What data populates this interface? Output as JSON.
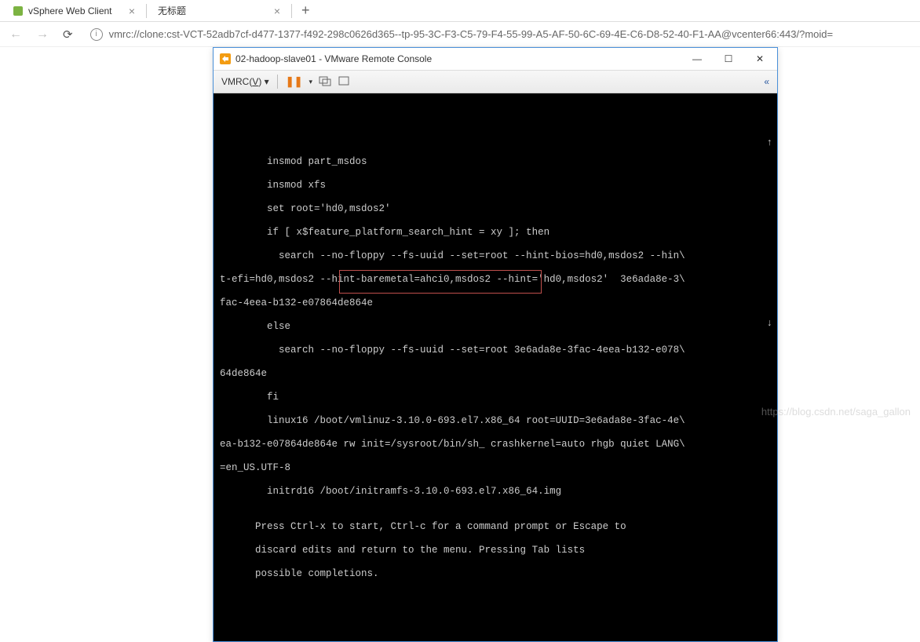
{
  "browser": {
    "tabs": [
      {
        "title": "vSphere Web Client",
        "favicon_color": "#7cb342"
      },
      {
        "title": "无标题",
        "favicon_color": "#999"
      }
    ],
    "url": "vmrc://clone:cst-VCT-52adb7cf-d477-1377-f492-298c0626d365--tp-95-3C-F3-C5-79-F4-55-99-A5-AF-50-6C-69-4E-C6-D8-52-40-F1-AA@vcenter66:443/?moid="
  },
  "vmrc": {
    "title": "02-hadoop-slave01 - VMware Remote Console",
    "menu_label": "VMRC(V)",
    "console_lines": [
      "        insmod part_msdos",
      "        insmod xfs",
      "        set root='hd0,msdos2'",
      "        if [ x$feature_platform_search_hint = xy ]; then",
      "          search --no-floppy --fs-uuid --set=root --hint-bios=hd0,msdos2 --hin\\",
      "t-efi=hd0,msdos2 --hint-baremetal=ahci0,msdos2 --hint='hd0,msdos2'  3e6ada8e-3\\",
      "fac-4eea-b132-e07864de864e",
      "        else",
      "          search --no-floppy --fs-uuid --set=root 3e6ada8e-3fac-4eea-b132-e078\\",
      "64de864e",
      "        fi",
      "        linux16 /boot/vmlinuz-3.10.0-693.el7.x86_64 root=UUID=3e6ada8e-3fac-4e\\",
      "ea-b132-e07864de864e rw init=/sysroot/bin/sh_ crashkernel=auto rhgb quiet LANG\\",
      "=en_US.UTF-8",
      "        initrd16 /boot/initramfs-3.10.0-693.el7.x86_64.img",
      "",
      "      Press Ctrl-x to start, Ctrl-c for a command prompt or Escape to",
      "      discard edits and return to the menu. Pressing Tab lists",
      "      possible completions."
    ],
    "highlighted_text": "rw init=/sysroot/bin/sh_"
  },
  "watermark": "https://blog.csdn.net/saga_gallon"
}
